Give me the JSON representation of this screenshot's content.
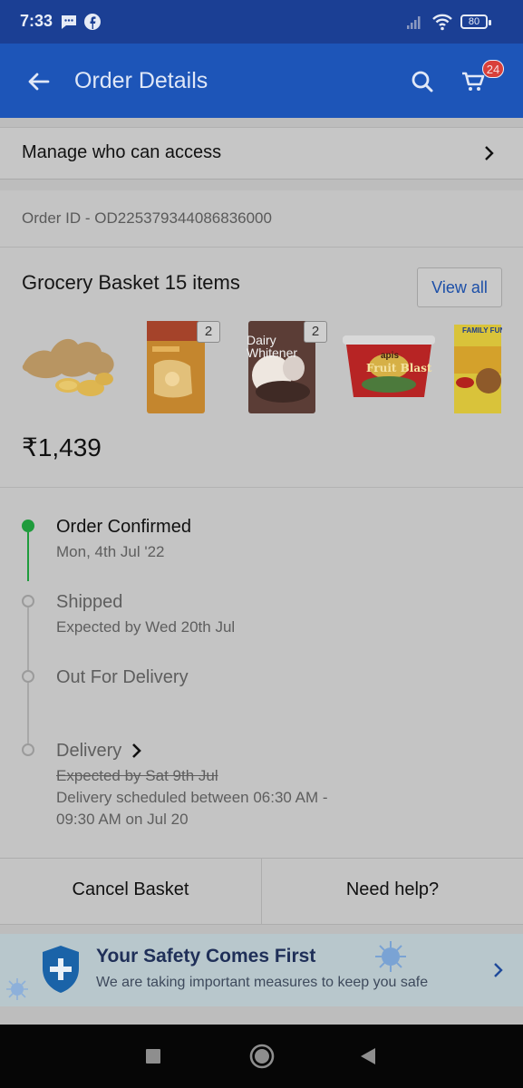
{
  "status_bar": {
    "time": "7:33",
    "battery": "80"
  },
  "app_bar": {
    "title": "Order Details",
    "cart_count": "24"
  },
  "manage_access": {
    "label": "Manage who can access"
  },
  "order": {
    "id_text": "Order ID - OD225379344086836000",
    "basket_title": "Grocery Basket 15 items",
    "view_all_label": "View all",
    "price": "₹1,439",
    "products": [
      {
        "name": "ginger-image",
        "qty": ""
      },
      {
        "name": "snack-pouch-image",
        "qty": "2"
      },
      {
        "name": "dairy-whitener-pack-image",
        "qty": "2",
        "pack_text": "Dairy Whitener"
      },
      {
        "name": "fruit-blast-cup-image",
        "qty": "",
        "pack_text": "Fruit Blast",
        "brand": "apis"
      },
      {
        "name": "noodles-pack-image",
        "qty": "",
        "pack_text": "FAMILY FUN P"
      }
    ]
  },
  "timeline": [
    {
      "title": "Order Confirmed",
      "subtitle": "Mon, 4th Jul '22",
      "done": true
    },
    {
      "title": "Shipped",
      "subtitle": "Expected by Wed 20th Jul",
      "done": false
    },
    {
      "title": "Out For Delivery",
      "subtitle": "",
      "done": false
    },
    {
      "title": "Delivery",
      "subtitle_struck": "Expected by Sat 9th Jul",
      "note_line1": "Delivery scheduled between 06:30 AM -",
      "note_line2": "09:30 AM on Jul 20",
      "done": false
    }
  ],
  "actions": {
    "cancel_label": "Cancel Basket",
    "help_label": "Need help?"
  },
  "safety_banner": {
    "title": "Your Safety Comes First",
    "subtitle": "We are taking important measures to keep you safe"
  },
  "colors": {
    "app_bar": "#1d55b8",
    "status_bar": "#1b3f94",
    "timeline_done": "#1f9b3c",
    "timeline_pending": "#9b9b9b",
    "badge": "#d9403a",
    "link_blue": "#1c4fa8"
  }
}
